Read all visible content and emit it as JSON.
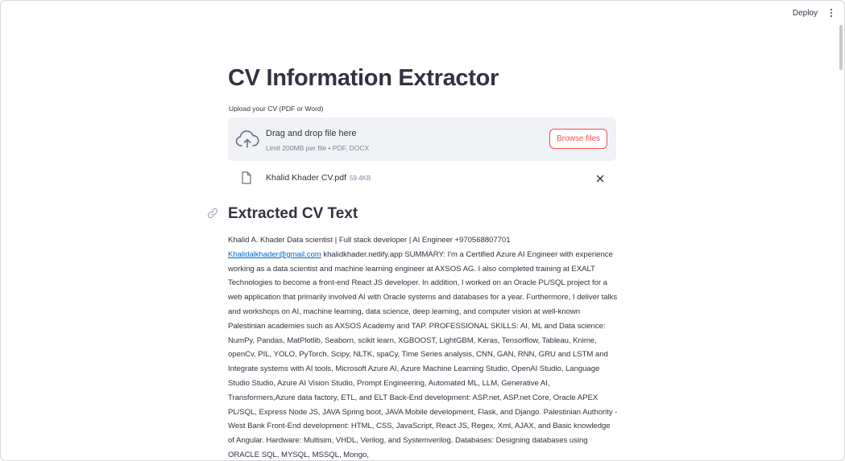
{
  "header": {
    "deploy_label": "Deploy"
  },
  "page": {
    "title": "CV Information Extractor"
  },
  "uploader": {
    "label": "Upload your CV (PDF or Word)",
    "drop_title": "Drag and drop file here",
    "drop_subtitle": "Limit 200MB per file • PDF, DOCX",
    "browse_label": "Browse files"
  },
  "uploaded_file": {
    "name": "Khalid Khader CV.pdf",
    "size": "59.4KB"
  },
  "extracted": {
    "heading": "Extracted CV Text",
    "text_before_email": "Khalid A. Khader Data scientist | Full stack developer | AI Engineer +970568807701",
    "email": "Khalidalkhader@gmail.com",
    "text_after_email": " khalidkhader.netlify.app SUMMARY: I'm a Certified Azure AI Engineer with experience working as a data scientist and machine learning engineer at AXSOS AG. I also completed training at EXALT Technologies to become a front-end React JS developer. In addition, I worked on an Oracle PL/SQL project for a web application that primarily involved AI with Oracle systems and databases for a year. Furthermore, I deliver talks and workshops on AI, machine learning, data science, deep learning, and computer vision at well-known Palestinian academies such as AXSOS Academy and TAP. PROFESSIONAL SKILLS: AI, ML and Data science: NumPy, Pandas, MatPlotlib, Seaborn, scikit learn, XGBOOST, LightGBM, Keras, Tensorflow, Tableau, Knime, openCv, PIL, YOLO, PyTorch, Scipy, NLTK, spaCy, Time Series analysis, CNN, GAN, RNN, GRU and LSTM and Integrate systems with AI tools, Microsoft Azure AI, Azure Machine Learning Studio, OpenAI Studio, Language Studio Studio, Azure AI Vision Studio, Prompt Engineering, Automated ML, LLM, Generative AI, Transformers,Azure data factory, ETL, and ELT Back-End development: ASP.net, ASP.net Core, Oracle APEX PL/SQL, Express Node JS, JAVA Spring boot, JAVA Mobile development, Flask, and Django. Palestinian Authority - West Bank Front-End development: HTML, CSS, JavaScript, React JS, Regex, Xml, AJAX, and Basic knowledge of Angular. Hardware: Multisim, VHDL, Verilog, and Systemverilog. Databases: Designing databases using ORACLE SQL, MYSQL, MSSQL, Mongo,"
  },
  "icons": {
    "upload": "cloud-upload-icon",
    "file": "file-icon",
    "delete": "close-icon",
    "anchor": "link-icon",
    "menu": "kebab-menu-icon"
  },
  "colors": {
    "accent": "#ff4b4b",
    "link": "#0068c9",
    "text": "#31333f",
    "muted": "#808495",
    "dropzone_bg": "#f0f2f6"
  }
}
